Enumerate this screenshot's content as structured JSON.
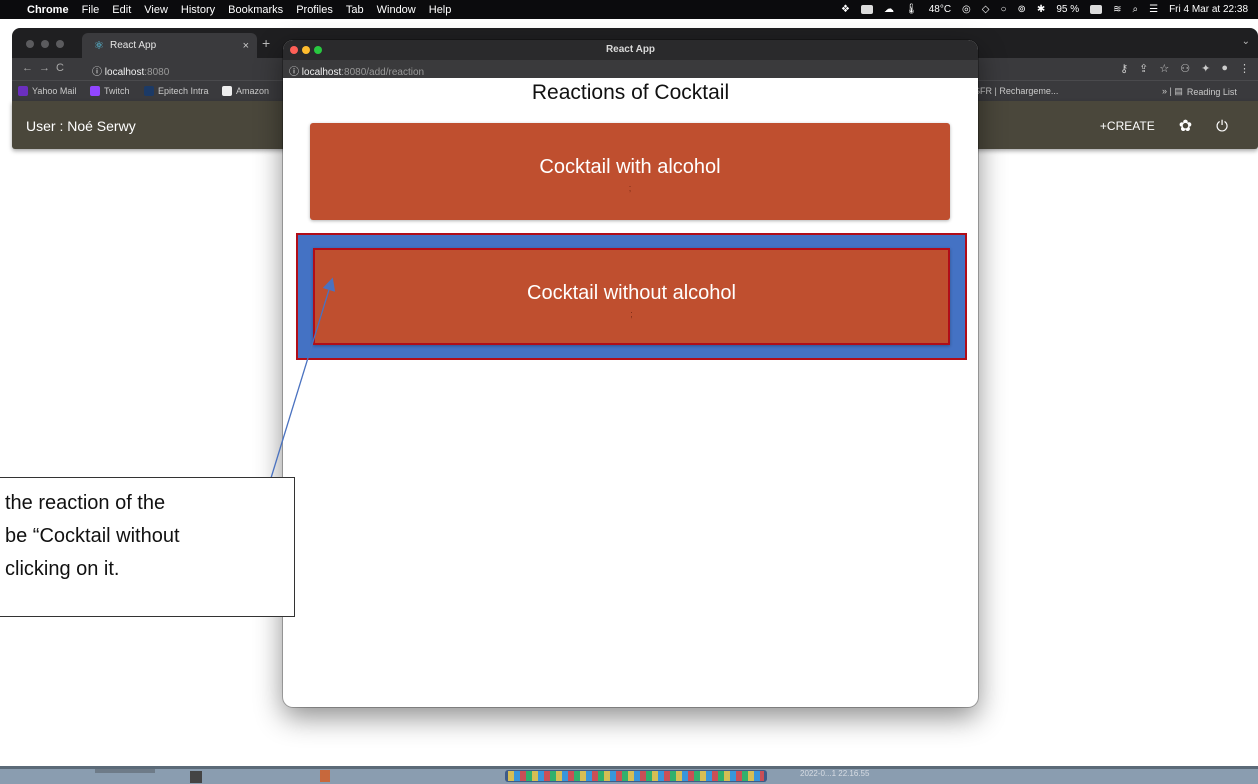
{
  "menubar": {
    "apple": "",
    "app_name": "Chrome",
    "items": [
      "File",
      "Edit",
      "View",
      "History",
      "Bookmarks",
      "Profiles",
      "Tab",
      "Window",
      "Help"
    ],
    "temperature": "48°C",
    "battery": "95 %",
    "datetime": "Fri 4 Mar at 22:38"
  },
  "background_browser": {
    "tab_title": "React App",
    "url_host": "localhost",
    "url_port": ":8080",
    "bookmarks": [
      "Yahoo Mail",
      "Twitch",
      "Epitech Intra",
      "Amazon"
    ],
    "bookmark_right": "SFR | Rechargeme...",
    "reading_list": "Reading List",
    "app_header": {
      "user_label": "User : Noé Serwy",
      "create_label": "CREATE"
    }
  },
  "foreground_window": {
    "title": "React App",
    "url_host": "localhost",
    "url_rest": ":8080/add/reaction",
    "heading": "Reactions of Cocktail",
    "reactions": [
      {
        "label": "Cocktail with alcohol",
        "sub": ";"
      },
      {
        "label": "Cocktail without alcohol",
        "sub": ";"
      }
    ]
  },
  "annotation": {
    "callout_lines": [
      "the reaction of the",
      "be “Cocktail without",
      "clicking on it."
    ]
  },
  "dock": {
    "timestamp": "2022-0...1 22.16.55"
  },
  "colors": {
    "reaction_card": "#bf4f2f",
    "highlight_fill": "#4472c4",
    "highlight_border": "#b10d18",
    "app_header": "#4a473b"
  }
}
